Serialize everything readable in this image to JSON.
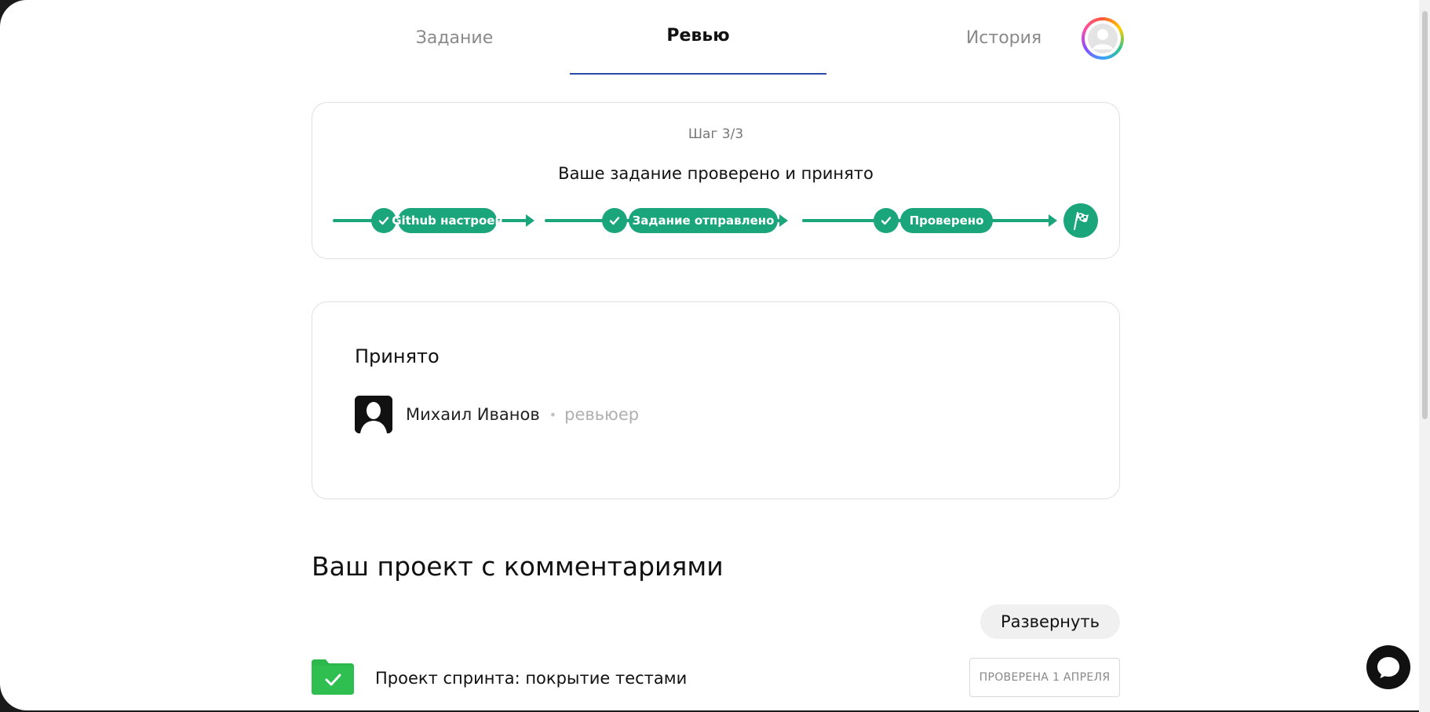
{
  "tabs": [
    {
      "label": "Задание"
    },
    {
      "label": "Ревью"
    },
    {
      "label": "История"
    }
  ],
  "progress": {
    "step_label": "Шаг 3/3",
    "title": "Ваше задание проверено и принято",
    "steps": [
      {
        "label": "Github настроен"
      },
      {
        "label": "Задание отправлено"
      },
      {
        "label": "Проверено"
      }
    ],
    "finish_icon": "checkered-flag-icon",
    "accent_color": "#1aa57a"
  },
  "review": {
    "status": "Принято",
    "reviewer_name": "Михаил Иванов",
    "separator": "•",
    "reviewer_role": "ревьюер"
  },
  "project_section": {
    "title": "Ваш проект с комментариями",
    "expand_label": "Развернуть",
    "project": {
      "name": "Проект спринта: покрытие тестами",
      "badge": "ПРОВЕРЕНА 1 АПРЕЛЯ"
    }
  },
  "colors": {
    "tab_underline": "#2b4aa8",
    "folder": "#2db84d"
  }
}
